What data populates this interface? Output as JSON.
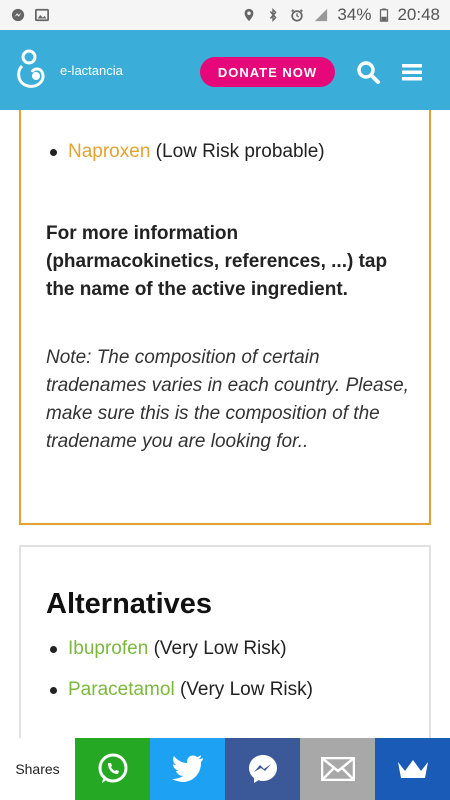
{
  "status_bar": {
    "battery": "34%",
    "time": "20:48",
    "icons": [
      "messenger-icon",
      "image-icon",
      "location-icon",
      "bluetooth-icon",
      "alarm-icon",
      "signal-icon",
      "battery-icon"
    ]
  },
  "header": {
    "site_name": "e-lactancia",
    "donate_label": "DONATE NOW",
    "icons": [
      "search-icon",
      "menu-icon"
    ],
    "colors": {
      "bar": "#3aaed8",
      "donate": "#e6087a"
    }
  },
  "tradename_card": {
    "ingredients": [
      {
        "name": "Naproxen",
        "risk": "(Low Risk probable)"
      }
    ],
    "info_text": "For more information (pharmacokinetics, references, ...) tap the name of the active ingredient.",
    "note_text": "Note: The composition of certain tradenames varies in each country. Please, make sure this is the composition of the tradename you are looking for.."
  },
  "alternatives": {
    "title": "Alternatives",
    "items": [
      {
        "name": "Ibuprofen",
        "risk": "(Very Low Risk)"
      },
      {
        "name": "Paracetamol",
        "risk": "(Very Low Risk)"
      }
    ]
  },
  "share_bar": {
    "label": "Shares",
    "buttons": [
      {
        "name": "whatsapp-icon",
        "color": "#25a924"
      },
      {
        "name": "twitter-icon",
        "color": "#1da1f2"
      },
      {
        "name": "messenger-icon",
        "color": "#3b5998"
      },
      {
        "name": "email-icon",
        "color": "#a8a8a8"
      },
      {
        "name": "crown-icon",
        "color": "#1a5bb8"
      }
    ]
  }
}
